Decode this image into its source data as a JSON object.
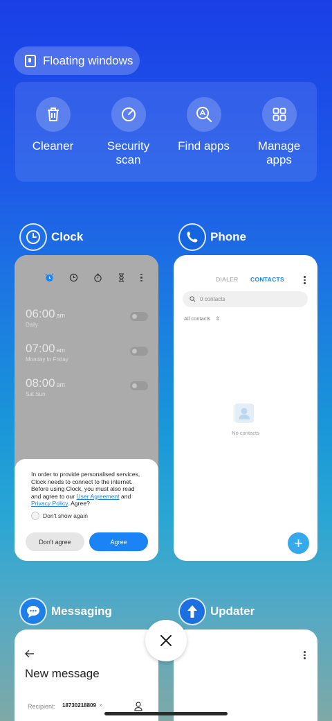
{
  "floating_windows": {
    "label": "Floating windows"
  },
  "tools": [
    {
      "label": "Cleaner",
      "icon": "trash-icon"
    },
    {
      "label": "Security\nscan",
      "icon": "security-scan-icon"
    },
    {
      "label": "Find apps",
      "icon": "find-apps-icon"
    },
    {
      "label": "Manage\napps",
      "icon": "grid-icon"
    }
  ],
  "apps": {
    "clock": {
      "name": "Clock",
      "alarms": [
        {
          "time": "06:00",
          "ampm": "am",
          "days": "Daily"
        },
        {
          "time": "07:00",
          "ampm": "am",
          "days": "Monday to Friday"
        },
        {
          "time": "08:00",
          "ampm": "am",
          "days": "Sat Sun"
        }
      ],
      "dialog": {
        "text_before": "In order to provide personalised services, Clock needs to connect to the internet. Before using Clock, you must also read and agree to our ",
        "link1": "User Agreement",
        "text_mid": " and ",
        "link2": "Privacy Policy",
        "text_after": ". Agree?",
        "checkbox": "Don't show again",
        "decline": "Don't agree",
        "accept": "Agree"
      }
    },
    "phone": {
      "name": "Phone",
      "tab_dialer": "DIALER",
      "tab_contacts": "CONTACTS",
      "search_placeholder": "0 contacts",
      "filter": "All contacts",
      "empty": "No contacts",
      "fab": "+"
    },
    "messaging": {
      "name": "Messaging",
      "title": "New message",
      "recipient_label": "Recipient:",
      "recipient_value": "18730218809"
    },
    "updater": {
      "name": "Updater"
    }
  },
  "colors": {
    "accent": "#1a84f7",
    "fab": "#36a9ec"
  }
}
